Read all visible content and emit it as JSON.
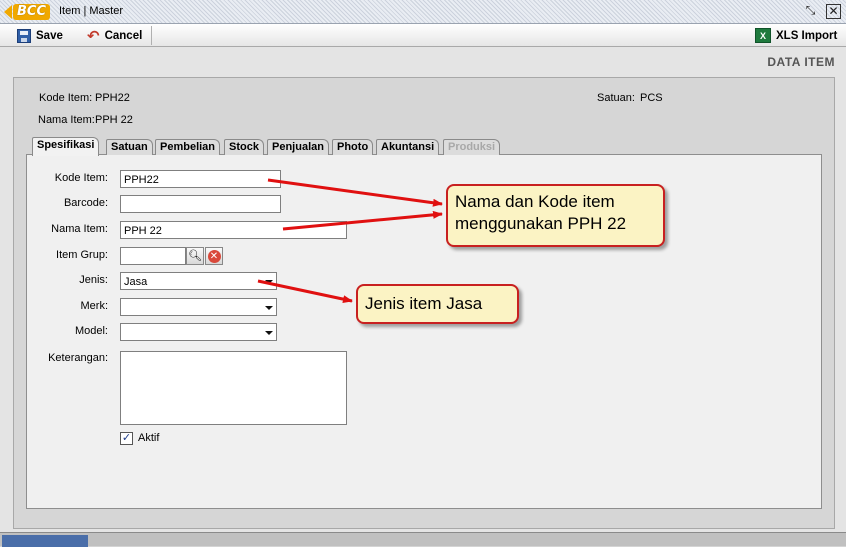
{
  "window": {
    "title": "Item | Master",
    "logo_text": "BCC"
  },
  "toolbar": {
    "save_label": "Save",
    "cancel_label": "Cancel",
    "import_label": "XLS Import"
  },
  "header": {
    "section_title": "DATA ITEM"
  },
  "info": {
    "kode_label": "Kode Item:",
    "kode_value": "PPH22",
    "nama_label": "Nama Item:",
    "nama_value": "PPH 22",
    "satuan_label": "Satuan:",
    "satuan_value": "PCS"
  },
  "tabs": [
    {
      "label": "Spesifikasi",
      "state": "active"
    },
    {
      "label": "Satuan",
      "state": "normal"
    },
    {
      "label": "Pembelian",
      "state": "normal"
    },
    {
      "label": "Stock",
      "state": "normal"
    },
    {
      "label": "Penjualan",
      "state": "normal"
    },
    {
      "label": "Photo",
      "state": "normal"
    },
    {
      "label": "Akuntansi",
      "state": "normal"
    },
    {
      "label": "Produksi",
      "state": "disabled"
    }
  ],
  "form": {
    "kode_label": "Kode Item:",
    "kode_value": "PPH22",
    "barcode_label": "Barcode:",
    "barcode_value": "",
    "nama_label": "Nama Item:",
    "nama_value": "PPH 22",
    "grup_label": "Item Grup:",
    "grup_value": "",
    "jenis_label": "Jenis:",
    "jenis_value": "Jasa",
    "merk_label": "Merk:",
    "merk_value": "",
    "model_label": "Model:",
    "model_value": "",
    "keterangan_label": "Keterangan:",
    "keterangan_value": "",
    "aktif_label": "Aktif",
    "aktif_checked": true
  },
  "callouts": {
    "nama_kode": "Nama dan Kode item menggunakan PPH 22",
    "jenis": "Jenis item Jasa"
  },
  "colors": {
    "arrow": "#e01010",
    "callout_border": "#c82020",
    "callout_fill": "#fbf3c4"
  }
}
